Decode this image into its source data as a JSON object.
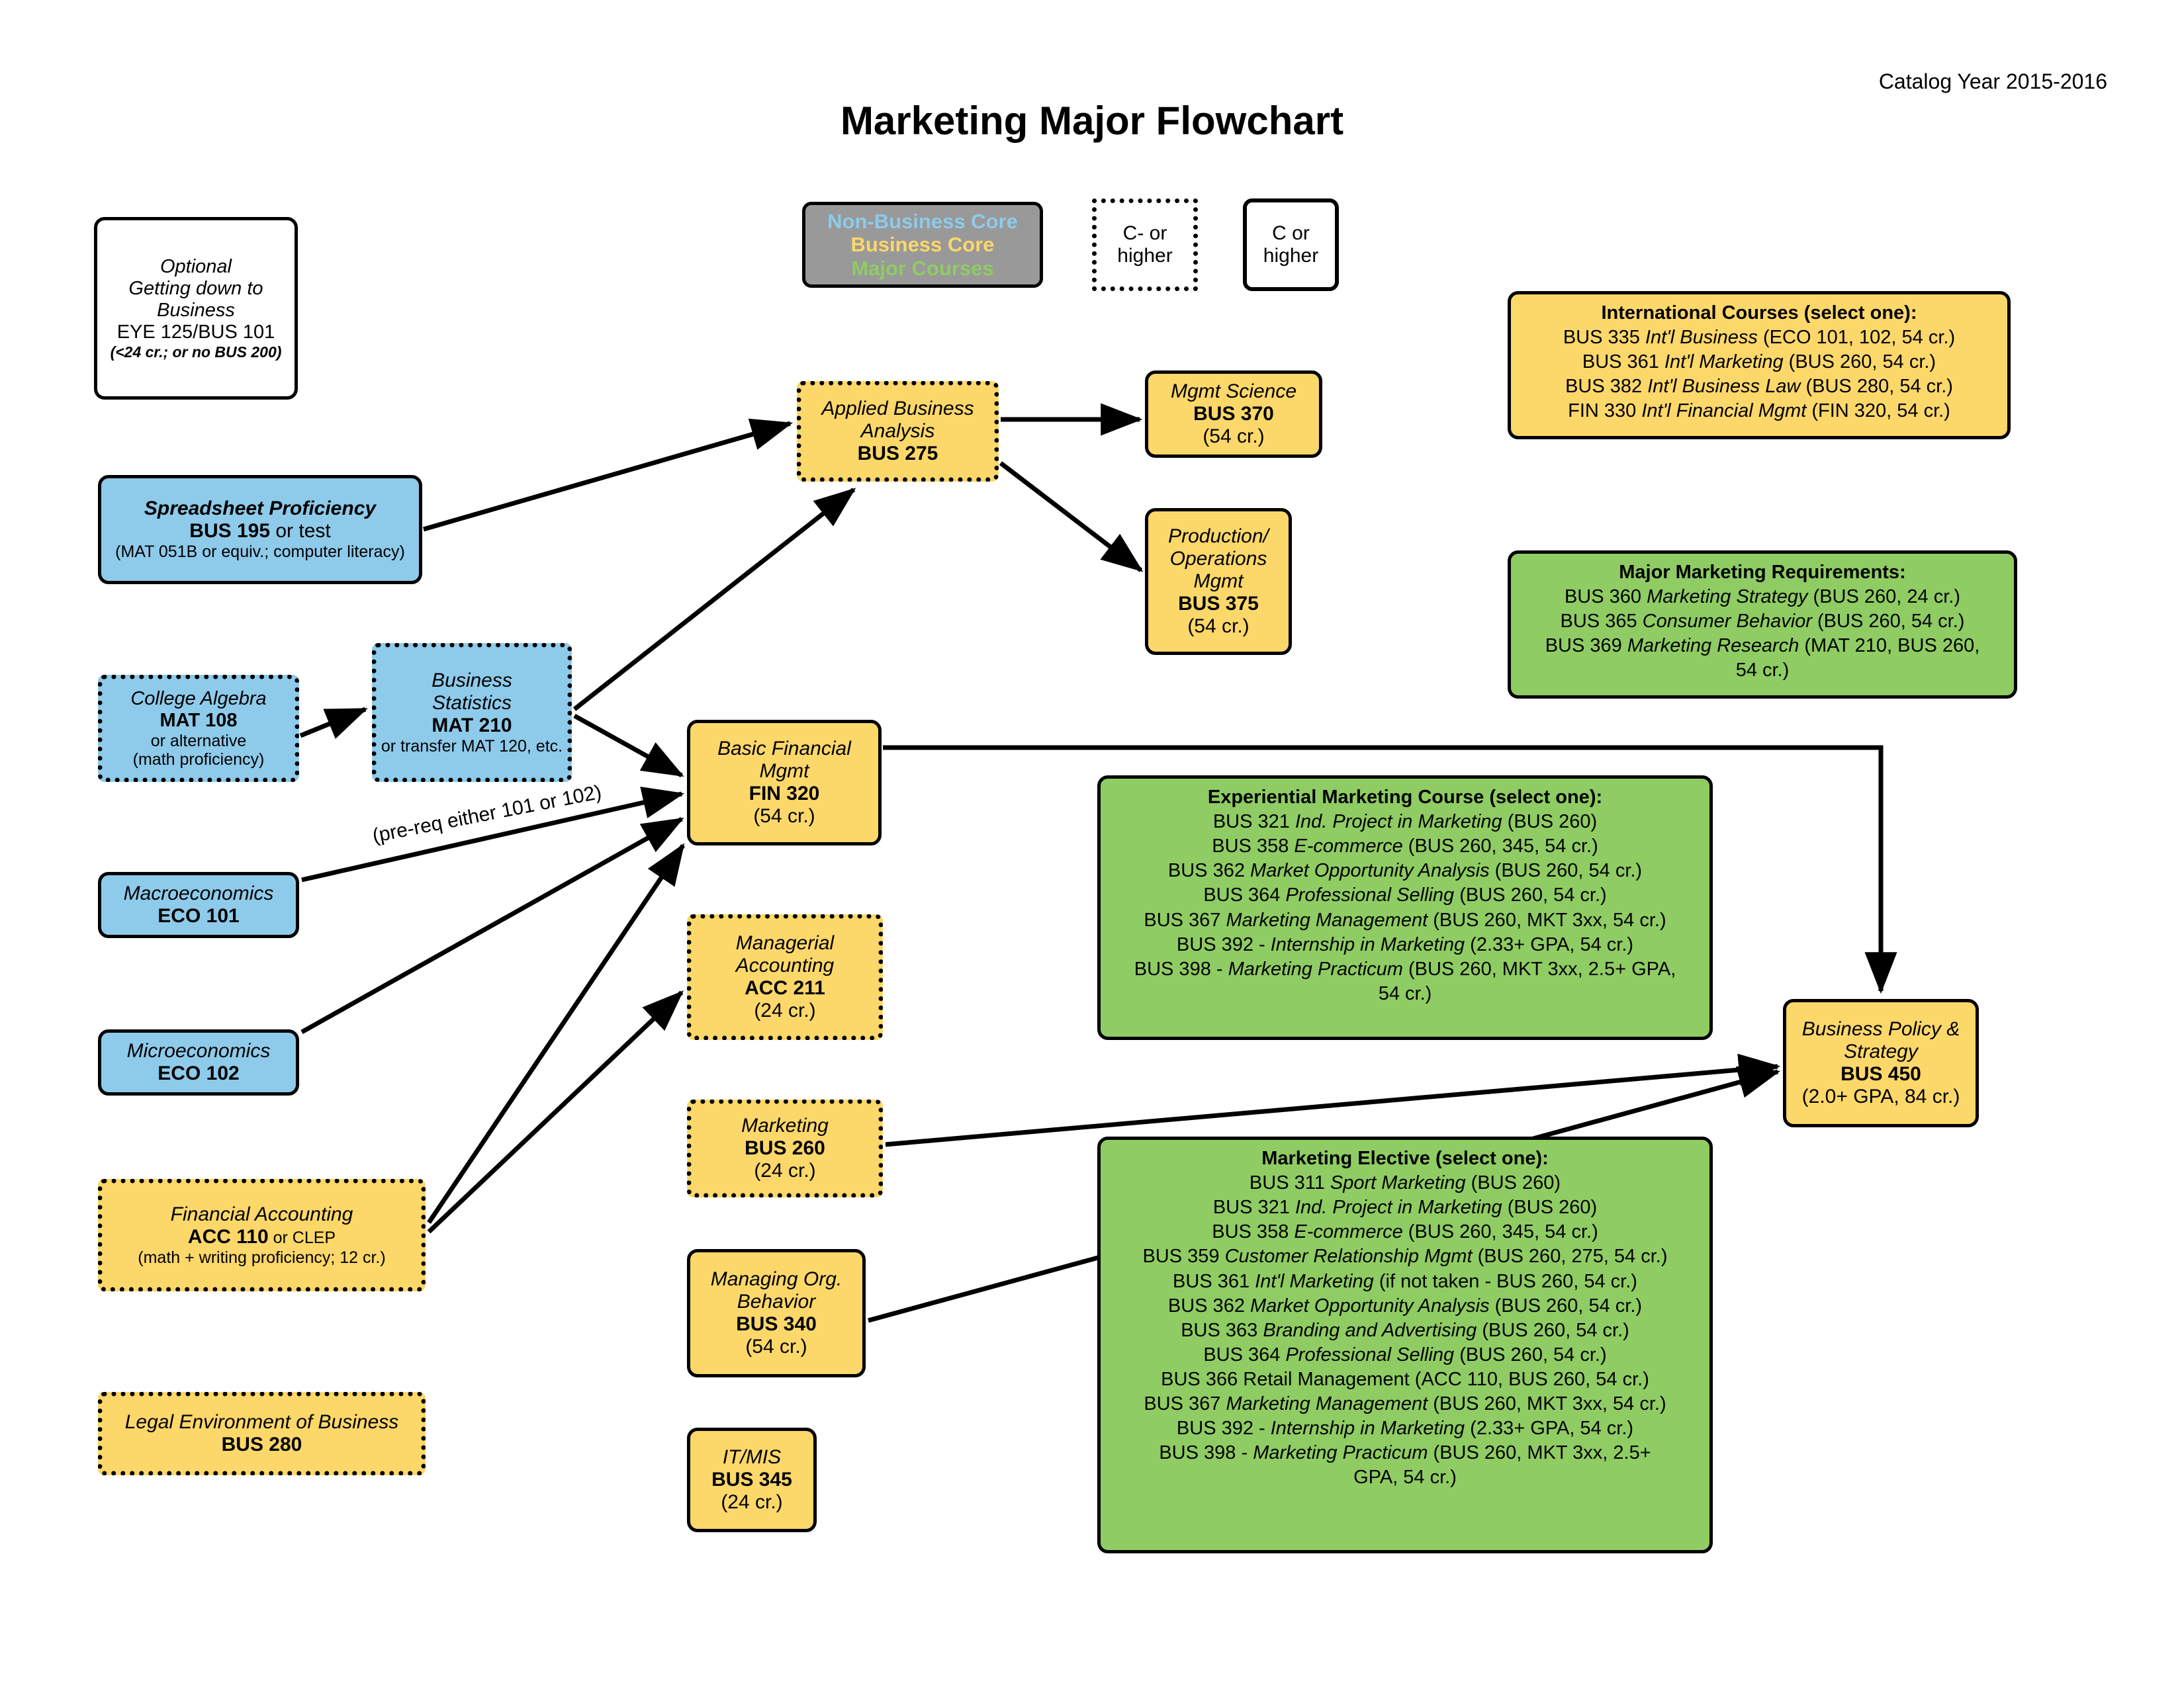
{
  "header": {
    "title": "Marketing Major Flowchart",
    "catalog_year": "Catalog Year 2015-2016"
  },
  "legend": {
    "non_business_core": "Non-Business Core",
    "business_core": "Business Core",
    "major_courses": "Major Courses",
    "c_minus_or_higher": "C- or\nhigher",
    "c_minus_line1": "C- or",
    "c_minus_line2": "higher",
    "c_or_higher_line1": "C or",
    "c_or_higher_line2": "higher",
    "colors": {
      "non_business_core": "#8ECAEA",
      "business_core": "#FCD76A",
      "major_courses": "#8FCC63",
      "legend_background": "#999999",
      "border": "#000000"
    }
  },
  "edge_labels": {
    "prereq_101_102": "(pre-req either 101 or 102)"
  },
  "nodes": {
    "optional": {
      "l1": "Optional",
      "l2": "Getting down to",
      "l3": "Business",
      "l4": "EYE 125/BUS 101",
      "l5": "(<24 cr.; or no BUS 200)"
    },
    "bus195": {
      "l1": "Spreadsheet Proficiency",
      "l2a": "BUS 195",
      "l2b": " or test",
      "l3": "(MAT 051B or equiv.; computer literacy)"
    },
    "mat108": {
      "l1": "College Algebra",
      "l2": "MAT 108",
      "l3": "or alternative",
      "l4": "(math proficiency)"
    },
    "mat210": {
      "l1": "Business",
      "l2": "Statistics",
      "l3": "MAT 210",
      "l4": "or transfer MAT 120, etc."
    },
    "eco101": {
      "l1": "Macroeconomics",
      "l2": "ECO 101"
    },
    "eco102": {
      "l1": "Microeconomics",
      "l2": "ECO 102"
    },
    "acc110": {
      "l1": "Financial Accounting",
      "l2a": "ACC 110",
      "l2b": " or CLEP",
      "l3": "(math + writing proficiency; 12 cr.)"
    },
    "bus280": {
      "l1": "Legal Environment of Business",
      "l2": "BUS 280"
    },
    "bus275": {
      "l1": "Applied Business",
      "l2": "Analysis",
      "l3": "BUS 275"
    },
    "bus370": {
      "l1": "Mgmt Science",
      "l2": "BUS 370",
      "l3": "(54 cr.)"
    },
    "bus375": {
      "l1": "Production/",
      "l2": "Operations",
      "l3": "Mgmt",
      "l4": "BUS 375",
      "l5": "(54 cr.)"
    },
    "fin320": {
      "l1": "Basic Financial",
      "l2": "Mgmt",
      "l3": "FIN 320",
      "l4": "(54 cr.)"
    },
    "acc211": {
      "l1": "Managerial",
      "l2": "Accounting",
      "l3": "ACC 211",
      "l4": "(24 cr.)"
    },
    "bus260": {
      "l1": "Marketing",
      "l2": "BUS 260",
      "l3": "(24 cr.)"
    },
    "bus340": {
      "l1": "Managing Org.",
      "l2": "Behavior",
      "l3": "BUS 340",
      "l4": "(54 cr.)"
    },
    "bus345": {
      "l1": "IT/MIS",
      "l2": "BUS 345",
      "l3": "(24 cr.)"
    },
    "bus450": {
      "l1": "Business Policy &",
      "l2": "Strategy",
      "l3": "BUS 450",
      "l4": "(2.0+ GPA, 84 cr.)"
    },
    "international": {
      "heading": "International Courses (select one):",
      "rows": [
        {
          "code": "BUS 335 ",
          "name": "Int'l Business",
          "paren": " (ECO 101, 102, 54 cr.)"
        },
        {
          "code": "BUS 361 ",
          "name": "Int'l Marketing",
          "paren": " (BUS 260, 54 cr.)"
        },
        {
          "code": "BUS 382 ",
          "name": "Int'l Business Law",
          "paren": " (BUS 280, 54 cr.)"
        },
        {
          "code": "FIN 330 ",
          "name": "Int'l Financial Mgmt",
          "paren": " (FIN 320, 54 cr.)"
        }
      ]
    },
    "major_requirements": {
      "heading": "Major Marketing Requirements:",
      "rows": [
        {
          "code": "BUS 360 ",
          "name": "Marketing Strategy",
          "paren": " (BUS 260, 24 cr.)"
        },
        {
          "code": "BUS 365 ",
          "name": "Consumer Behavior",
          "paren": " (BUS 260, 54 cr.)"
        },
        {
          "code": "BUS 369 ",
          "name": "Marketing Research",
          "paren": " (MAT 210, BUS 260,"
        },
        {
          "code": "",
          "name": "",
          "paren": "54 cr.)"
        }
      ]
    },
    "experiential": {
      "heading": "Experiential Marketing Course (select one):",
      "rows": [
        {
          "code": "BUS 321 ",
          "name": "Ind. Project in Marketing",
          "paren": " (BUS 260)"
        },
        {
          "code": "BUS 358 ",
          "name": "E-commerce",
          "paren": " (BUS 260, 345, 54 cr.)"
        },
        {
          "code": "BUS 362 ",
          "name": "Market Opportunity Analysis",
          "paren": " (BUS 260, 54 cr.)"
        },
        {
          "code": "BUS 364 ",
          "name": "Professional Selling",
          "paren": " (BUS 260, 54 cr.)"
        },
        {
          "code": "BUS 367 ",
          "name": "Marketing Management",
          "paren": " (BUS 260, MKT 3xx, 54 cr.)"
        },
        {
          "code": "BUS 392 - ",
          "name": "Internship in Marketing",
          "paren": " (2.33+ GPA, 54 cr.)"
        },
        {
          "code": "BUS 398 - ",
          "name": "Marketing Practicum",
          "paren": " (BUS 260, MKT 3xx, 2.5+ GPA,"
        },
        {
          "code": "",
          "name": "",
          "paren": "54 cr.)"
        }
      ]
    },
    "elective": {
      "heading": "Marketing Elective (select one):",
      "rows": [
        {
          "code": "BUS 311 ",
          "name": "Sport Marketing",
          "paren": " (BUS 260)"
        },
        {
          "code": "BUS 321 ",
          "name": "Ind. Project in Marketing",
          "paren": " (BUS 260)"
        },
        {
          "code": "BUS 358 ",
          "name": "E-commerce",
          "paren": " (BUS 260, 345, 54 cr.)"
        },
        {
          "code": "BUS 359 ",
          "name": "Customer Relationship Mgmt",
          "paren": " (BUS 260, 275, 54 cr.)"
        },
        {
          "code": "BUS 361 ",
          "name": "Int'l Marketing",
          "paren": " (if not taken - BUS 260, 54 cr.)"
        },
        {
          "code": "BUS 362 ",
          "name": "Market Opportunity Analysis",
          "paren": " (BUS 260, 54 cr.)"
        },
        {
          "code": "BUS 363 ",
          "name": "Branding and Advertising",
          "paren": " (BUS 260, 54 cr.)"
        },
        {
          "code": "BUS 364 ",
          "name": "Professional Selling",
          "paren": " (BUS 260, 54 cr.)"
        },
        {
          "code": "BUS 366 Retail Management",
          "name": "",
          "paren": " (ACC 110, BUS 260, 54 cr.)"
        },
        {
          "code": "BUS 367 ",
          "name": "Marketing Management",
          "paren": " (BUS 260, MKT 3xx, 54 cr.)"
        },
        {
          "code": "BUS 392 - ",
          "name": "Internship in Marketing",
          "paren": " (2.33+ GPA, 54 cr.)"
        },
        {
          "code": "BUS 398 - ",
          "name": "Marketing Practicum",
          "paren": " (BUS 260, MKT 3xx, 2.5+"
        },
        {
          "code": "",
          "name": "",
          "paren": "GPA, 54 cr.)"
        }
      ]
    }
  }
}
